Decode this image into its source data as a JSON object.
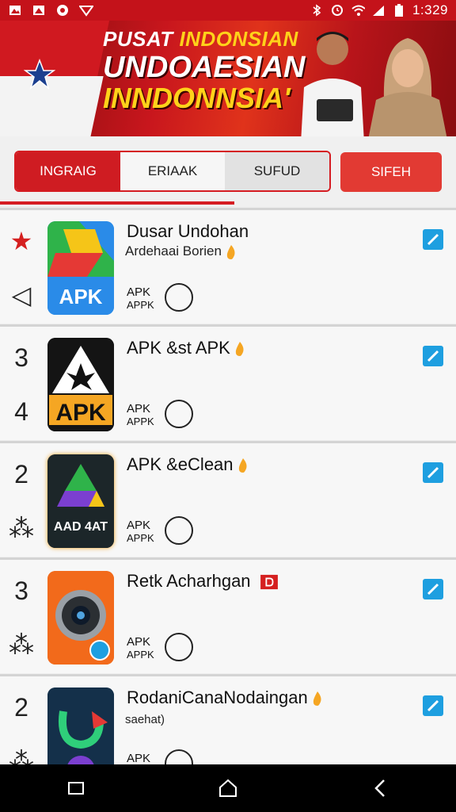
{
  "status_bar": {
    "time": "1:329",
    "left_icons": [
      "image-icon",
      "photo-icon",
      "messenger-icon",
      "vpn-icon"
    ],
    "right_icons": [
      "bluetooth-icon",
      "alarm-icon",
      "wifi-icon",
      "signal-icon",
      "battery-icon"
    ],
    "bg_color": "#c4121a"
  },
  "banner": {
    "line1_white": "PUSAT",
    "line1_yellow": "INDONSIAN",
    "line2": "UNDOAESIAN",
    "line3": "INNDONNSIA'"
  },
  "tabs": {
    "items": [
      {
        "label": "INGRAIG",
        "active": true
      },
      {
        "label": "ERIAAK",
        "active": false
      },
      {
        "label": "SUFUD",
        "active": false
      }
    ],
    "right_button": "SIFEH"
  },
  "apps": [
    {
      "side_top": "★",
      "side_bottom": "◁",
      "title": "Dusar Undohan",
      "subtitle": "Ardehaai Borien",
      "tag": "APK",
      "tag_sub": "APPK",
      "icon": "apk-drive-icon",
      "icon_text": "APK",
      "checked": true
    },
    {
      "side_top": "3",
      "side_bottom": "4",
      "title": "APK &st APK",
      "subtitle": "",
      "tag": "APK",
      "tag_sub": "APPK",
      "icon": "apk-warning-icon",
      "icon_text": "APK",
      "checked": true
    },
    {
      "side_top": "2",
      "side_bottom": "⁂",
      "title": "APK &eClean",
      "subtitle": "",
      "tag": "APK",
      "tag_sub": "APPK",
      "icon": "drive-triangle-icon",
      "icon_text": "AAD 4AT",
      "checked": true
    },
    {
      "side_top": "3",
      "side_bottom": "⁂",
      "title": "Retk Acharhgan",
      "subtitle": "",
      "tag": "APK",
      "tag_sub": "APPK",
      "icon": "camera-lens-icon",
      "icon_text": "",
      "checked": true
    },
    {
      "side_top": "2",
      "side_bottom": "⁂",
      "title": "RodaniCanaNodaingan",
      "subtitle": "saehat)",
      "tag": "APK",
      "tag_sub": "",
      "icon": "refresh-arrow-icon",
      "icon_text": "",
      "checked": true
    }
  ],
  "navbar": {
    "buttons": [
      "recents-icon",
      "home-icon",
      "back-icon"
    ]
  },
  "colors": {
    "accent_red": "#d51c22",
    "check_blue": "#1e9fe0"
  }
}
